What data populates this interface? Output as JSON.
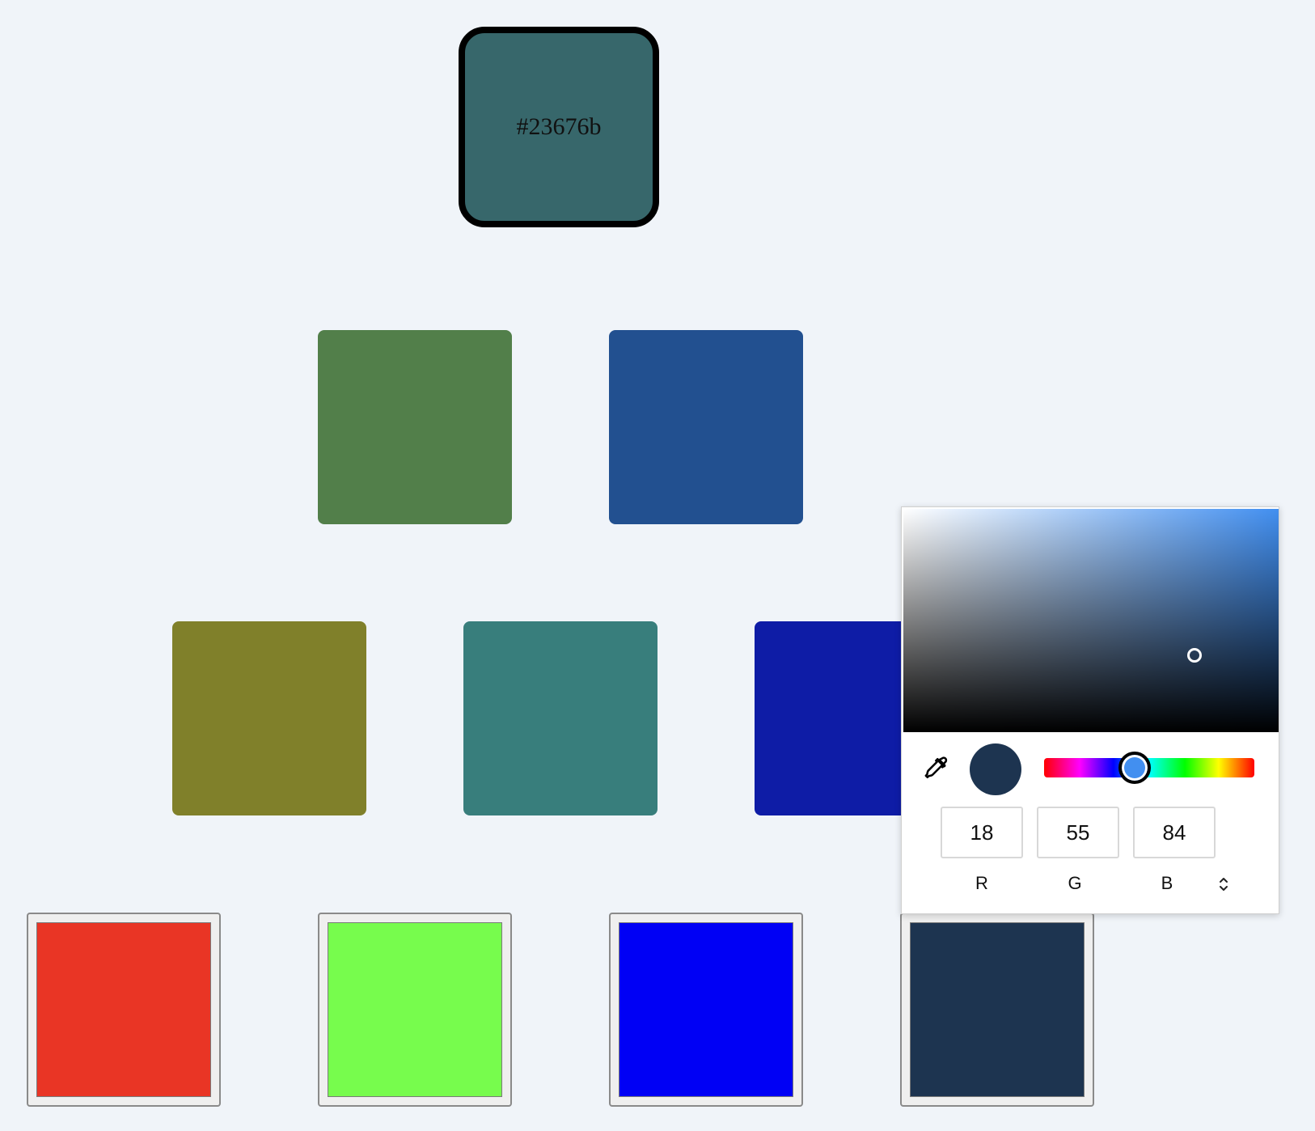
{
  "top_swatch": {
    "label": "#23676b",
    "color": "#37676b"
  },
  "swatches": [
    {
      "name": "swatch-green",
      "color": "#527f4a"
    },
    {
      "name": "swatch-blue",
      "color": "#225090"
    },
    {
      "name": "swatch-olive",
      "color": "#80802a"
    },
    {
      "name": "swatch-teal",
      "color": "#387e7c"
    },
    {
      "name": "swatch-indigo",
      "color": "#0e1ca6"
    }
  ],
  "color_inputs": [
    {
      "name": "color-input-red",
      "color": "#e93525"
    },
    {
      "name": "color-input-lime",
      "color": "#77fc4d"
    },
    {
      "name": "color-input-blue",
      "color": "#0000f5"
    },
    {
      "name": "color-input-navy",
      "color": "#1d3450"
    }
  ],
  "picker": {
    "hue_color": "#428ff0",
    "current_color": "#1d3450",
    "hue_position": 0.43,
    "r": "18",
    "g": "55",
    "b": "84",
    "r_label": "R",
    "g_label": "G",
    "b_label": "B",
    "eyedropper_icon": "eyedropper-icon",
    "mode_toggle_icon": "up-down-arrows-icon"
  }
}
